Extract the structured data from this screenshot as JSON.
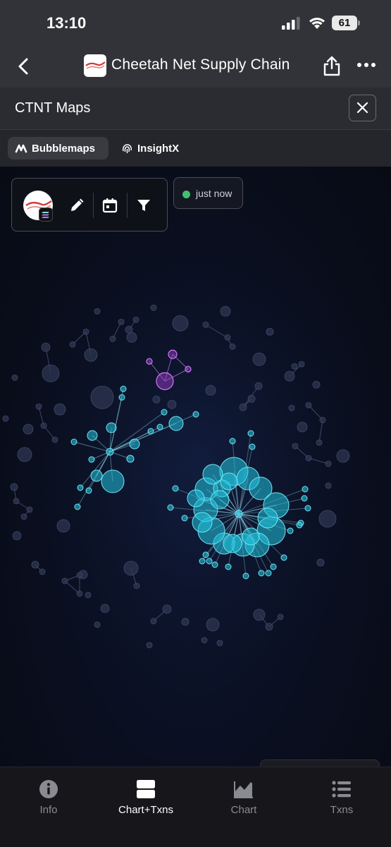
{
  "status_bar": {
    "time": "13:10",
    "battery": "61"
  },
  "nav": {
    "title": "Cheetah Net Supply Chain"
  },
  "sheet": {
    "title": "CTNT Maps"
  },
  "tabs": [
    {
      "label": "Bubblemaps",
      "active": true
    },
    {
      "label": "InsightX",
      "active": false
    }
  ],
  "map": {
    "status_text": "just now",
    "status_color": "#3fbf72",
    "node_colors": {
      "cluster": "#22c3dd",
      "purple": "#a23fd6",
      "gray": "#2e3552"
    }
  },
  "bottom_tabs": [
    {
      "label": "Info",
      "icon": "info-icon",
      "active": false
    },
    {
      "label": "Chart+Txns",
      "icon": "split-view-icon",
      "active": true
    },
    {
      "label": "Chart",
      "icon": "area-chart-icon",
      "active": false
    },
    {
      "label": "Txns",
      "icon": "list-icon",
      "active": false
    }
  ]
}
